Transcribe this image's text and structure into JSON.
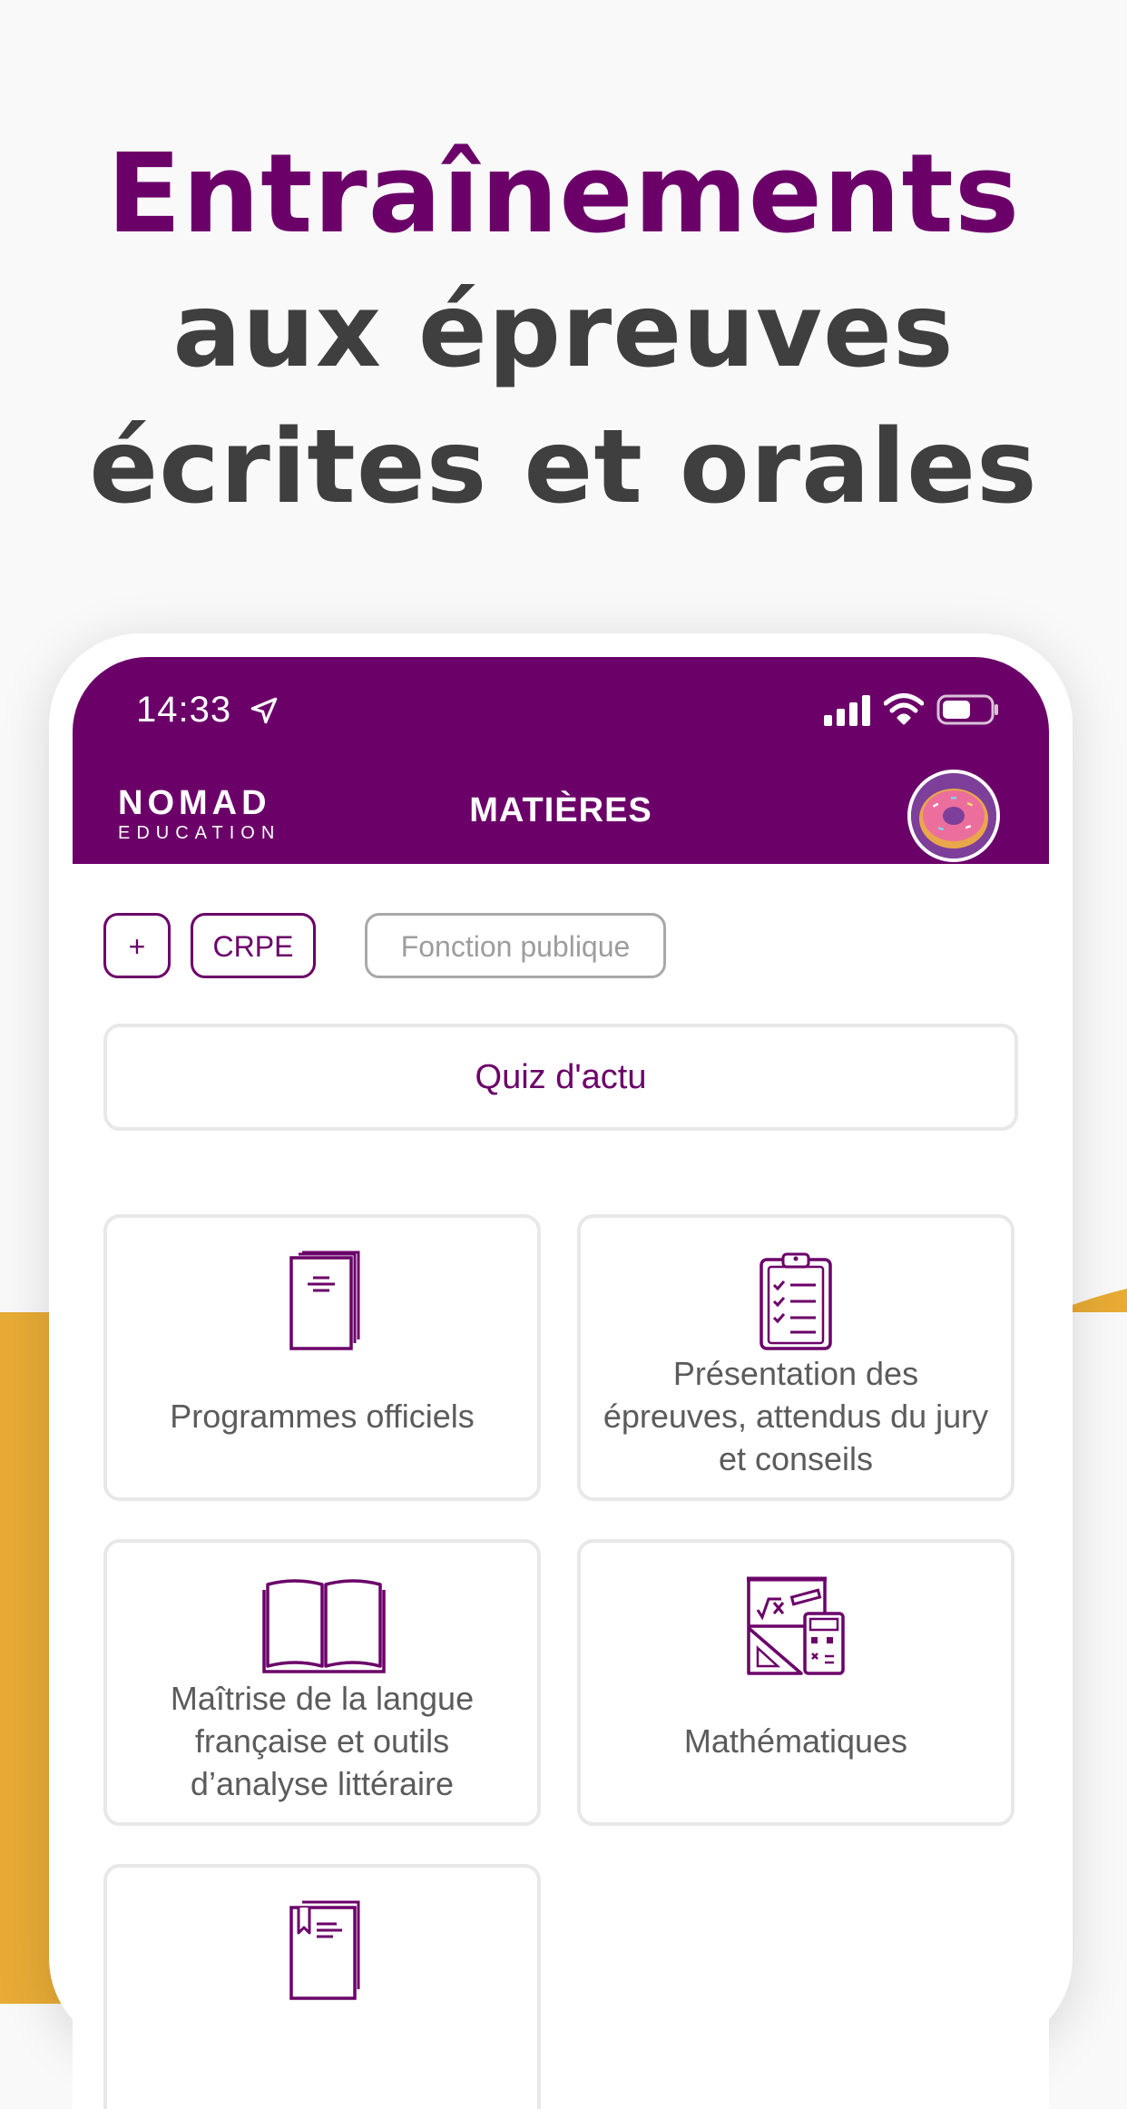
{
  "headline": {
    "line1": "Entraînements",
    "line2": "aux épreuves",
    "line3": "écrites et orales"
  },
  "colors": {
    "brand": "#6b0069",
    "accent_wave": "#e8ab35",
    "headline_dark": "#3f3f3f",
    "background": "#f9f9f9"
  },
  "status_bar": {
    "time": "14:33",
    "icons": [
      "location-arrow-icon",
      "signal-icon",
      "wifi-icon",
      "battery-icon"
    ]
  },
  "appbar": {
    "logo_main": "NOMAD",
    "logo_sub": "EDUCATION",
    "title": "MATIÈRES",
    "avatar_icon": "donut-avatar-icon"
  },
  "filters": {
    "add_label": "+",
    "chips": [
      {
        "label": "CRPE",
        "selected": true
      },
      {
        "label": "Fonction publique",
        "selected": false
      }
    ]
  },
  "quiz_button": "Quiz d'actu",
  "subjects": [
    {
      "icon": "document-icon",
      "label": "Programmes officiels"
    },
    {
      "icon": "clipboard-checklist-icon",
      "label": "Présentation des épreuves, attendus du jury et conseils"
    },
    {
      "icon": "open-book-icon",
      "label": "Maîtrise de la langue française et outils d’analyse littéraire"
    },
    {
      "icon": "math-tools-icon",
      "label": "Mathématiques"
    },
    {
      "icon": "bookmarked-book-icon",
      "label": ""
    }
  ]
}
